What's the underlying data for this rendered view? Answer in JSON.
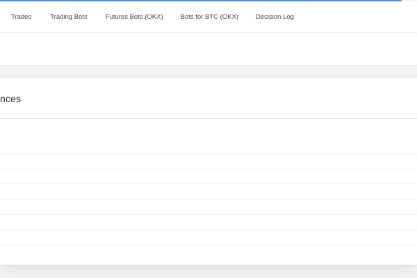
{
  "nav": {
    "tabs": [
      {
        "label": "Trades"
      },
      {
        "label": "Trading Bots"
      },
      {
        "label": "Futures Bots (OKX)"
      },
      {
        "label": "Bots for BTC (OKX)"
      },
      {
        "label": "Decision Log"
      }
    ]
  },
  "main": {
    "card": {
      "title": "nces"
    }
  },
  "colors": {
    "accent": "#5b84c4",
    "page_background": "#f1f2f4",
    "card_background": "#ffffff",
    "nav_text": "#3d4656"
  }
}
